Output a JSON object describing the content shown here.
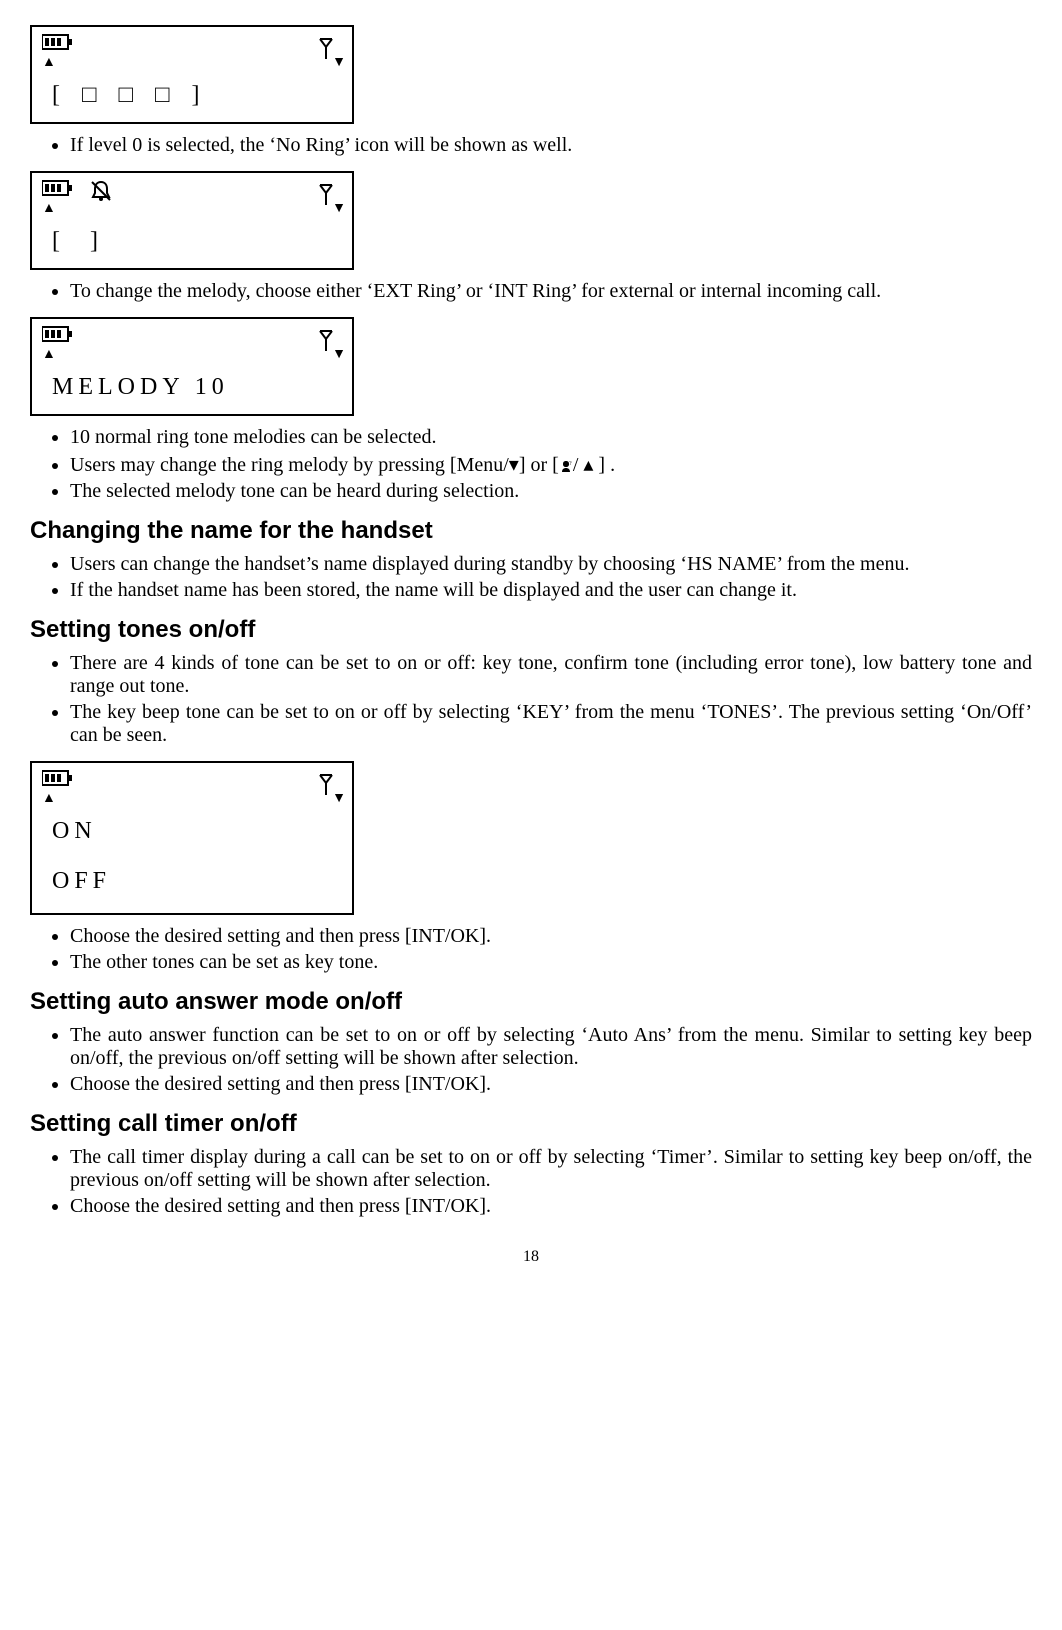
{
  "lcd1": {
    "content": "[ □ □ □     ]"
  },
  "bullet1": "If level 0 is selected, the ‘No Ring’ icon will be shown as well.",
  "lcd2": {
    "content": "[           ]"
  },
  "bullet2": "To change the melody, choose either ‘EXT Ring’ or ‘INT Ring’ for external or internal incoming call.",
  "lcd3": {
    "content": "MELODY  10"
  },
  "bullets3": [
    "10 normal ring tone melodies can be selected.",
    "Users may change the ring melody by pressing [Menu/▾] or  [",
    "The selected melody tone can be heard during selection."
  ],
  "bullets3_suffix": "/ ▴ ] .",
  "section1": "Changing the name for the handset",
  "bullets_s1": [
    "Users can change the handset’s name displayed during standby by choosing ‘HS NAME’ from the menu.",
    "If the handset name has been stored, the name will be displayed and the user can change it."
  ],
  "section2": "Setting tones on/off",
  "bullets_s2": [
    "There are 4 kinds of tone can be set to on or off: key tone, confirm tone (including error tone), low battery tone and range out tone.",
    "The key beep tone can be set to on or off by selecting ‘KEY’ from the menu ‘TONES’.   The previous setting ‘On/Off’ can be seen."
  ],
  "lcd4": {
    "line1": "ON",
    "line2": "OFF"
  },
  "bullets_after_lcd4": [
    "Choose the desired setting and then press [INT/OK].",
    "The other tones can be set as key tone."
  ],
  "section3": "Setting auto answer mode on/off",
  "bullets_s3": [
    "The auto answer function can be set to on or off by selecting ‘Auto Ans’ from the menu. Similar to setting key beep on/off, the previous on/off setting will be shown after selection.",
    "Choose the desired setting and then press [INT/OK]."
  ],
  "section4": "Setting call timer on/off",
  "bullets_s4": [
    "The call timer display during a call can be set to on or off by selecting ‘Timer’. Similar to setting key beep on/off, the previous on/off setting will be shown after selection.",
    "Choose the desired setting and then press [INT/OK]."
  ],
  "page_number": "18"
}
